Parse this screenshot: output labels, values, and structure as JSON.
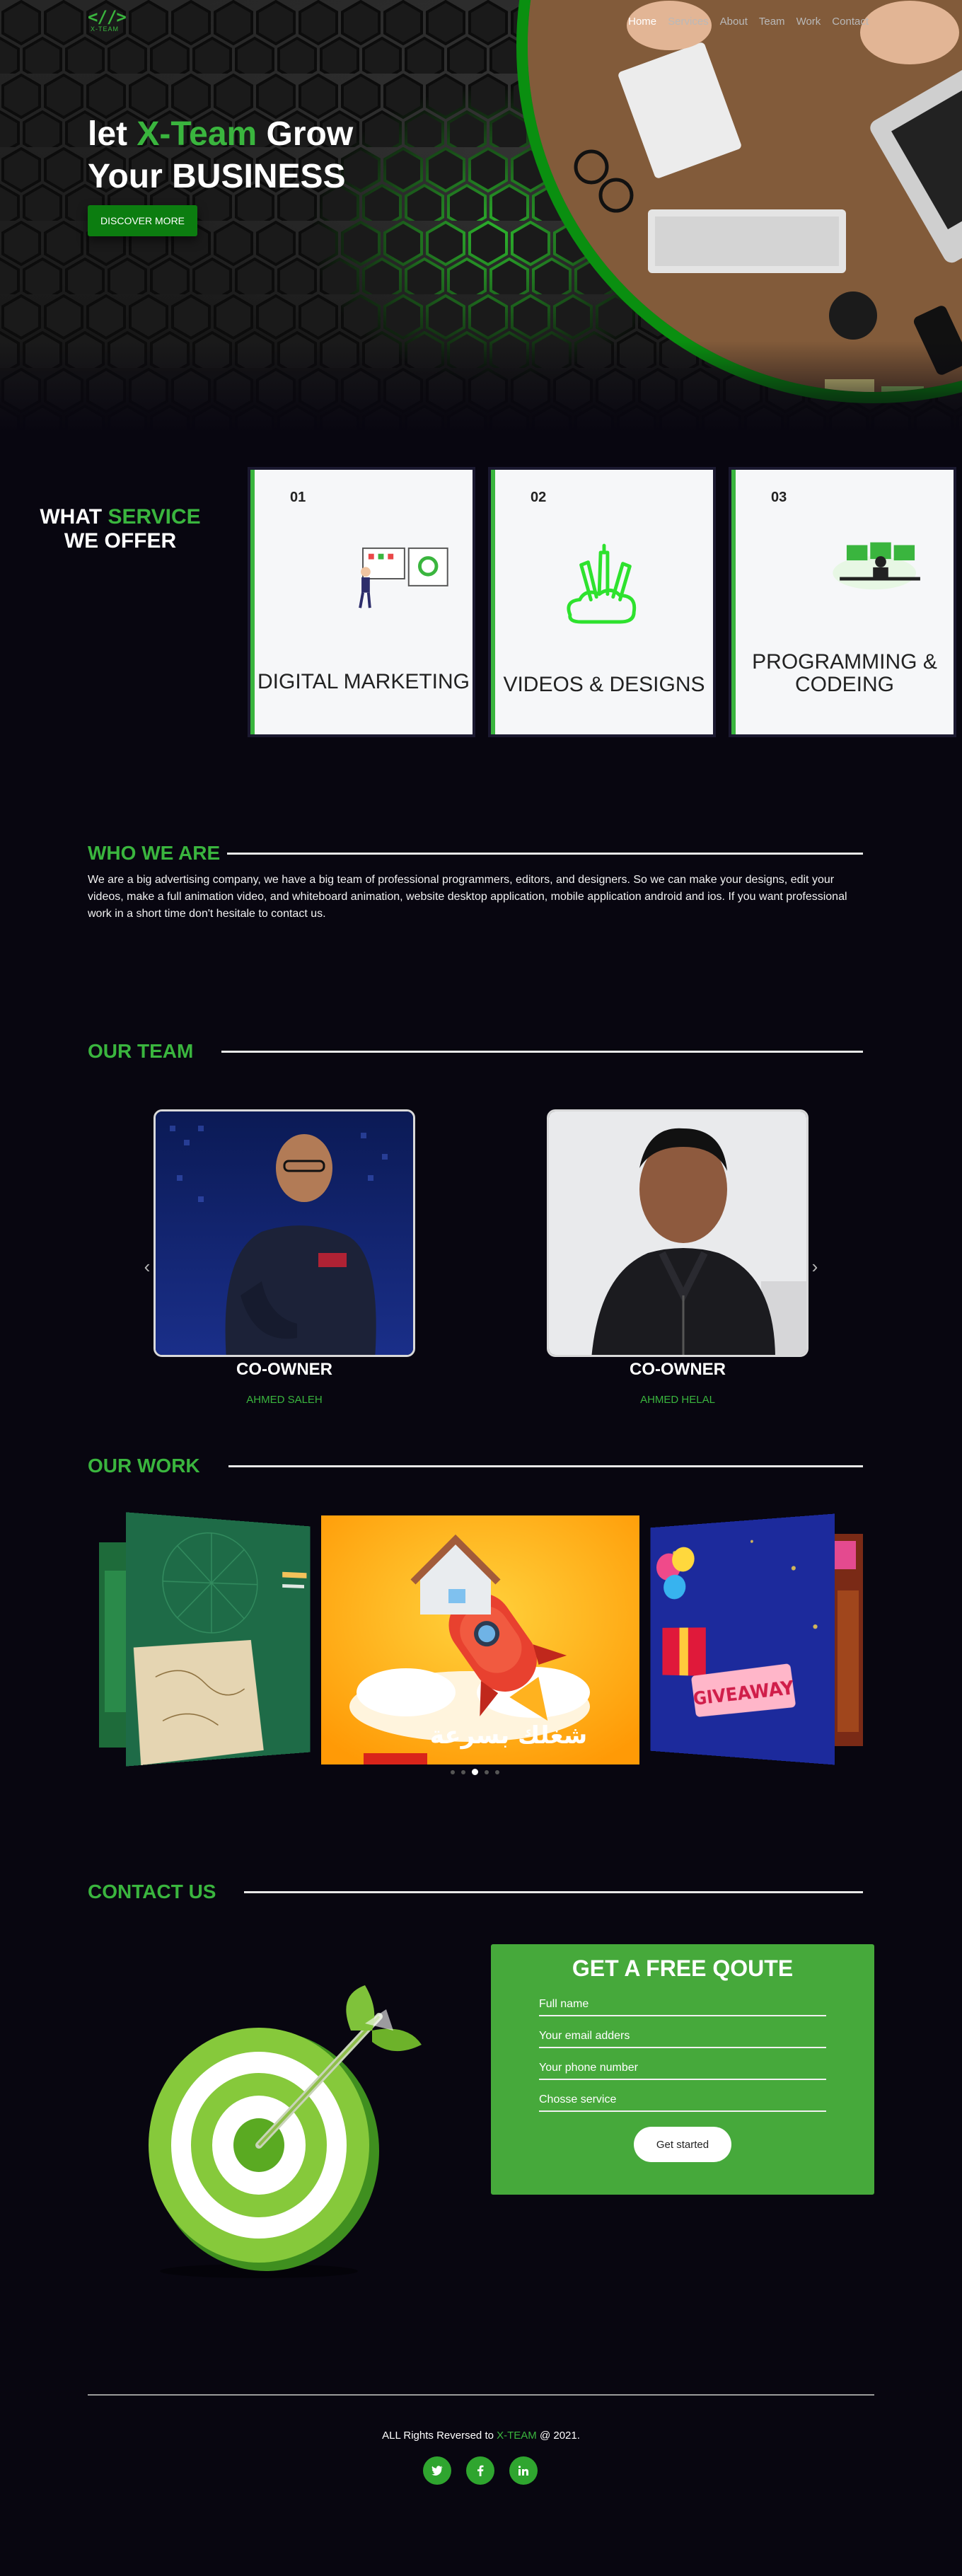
{
  "brand": {
    "logo_mark": "<//>",
    "logo_text": "X-TEAM",
    "accent": "#3ab53e"
  },
  "nav": {
    "items": [
      {
        "label": "Home",
        "active": true
      },
      {
        "label": "Services"
      },
      {
        "label": "About"
      },
      {
        "label": "Team"
      },
      {
        "label": "Work"
      },
      {
        "label": "Contact"
      }
    ]
  },
  "hero": {
    "title_prefix": "let ",
    "title_accent": "X-Team",
    "title_suffix": " Grow",
    "title_line2": "Your BUSINESS",
    "button": "DISCOVER MORE"
  },
  "services": {
    "heading_1": "WHAT ",
    "heading_accent": "SERVICE",
    "heading_2": "WE OFFER",
    "cards": [
      {
        "num": "01",
        "title": "DIGITAL MARKETING",
        "icon": "marketing-illustration"
      },
      {
        "num": "02",
        "title": "VIDEOS & DESIGNS",
        "icon": "design-tools-icon"
      },
      {
        "num": "03",
        "title": "PROGRAMMING & CODEING",
        "icon": "developer-illustration"
      }
    ]
  },
  "about": {
    "heading": "WHO WE ARE",
    "text": "We are a big advertising company, we have a big team of professional programmers, editors, and designers. So we can make your designs, edit your videos, make a full animation video, and whiteboard animation, website desktop application, mobile application android and ios. If you want professional work in a short time don't hesitale to contact us."
  },
  "team": {
    "heading": "OUR TEAM",
    "members": [
      {
        "role": "CO-OWNER",
        "name": "AHMED SALEH"
      },
      {
        "role": "CO-OWNER",
        "name": "AHMED HELAL"
      }
    ]
  },
  "work": {
    "heading": "OUR WORK",
    "featured_caption": "شغلك بسرعة",
    "featured_badge": "GIVEAWAY",
    "carousel_dots": 5,
    "active_dot": 3
  },
  "contact": {
    "heading": "CONTACT US",
    "form_title": "GET A FREE QOUTE",
    "fields": [
      "Full name",
      "Your email adders",
      "Your phone number",
      "Chosse service"
    ],
    "submit": "Get started"
  },
  "footer": {
    "copy_prefix": "ALL Rights Reversed to ",
    "copy_accent": "X-TEAM",
    "copy_suffix": " @ 2021.",
    "socials": [
      "twitter-icon",
      "facebook-icon",
      "linkedin-icon"
    ]
  }
}
